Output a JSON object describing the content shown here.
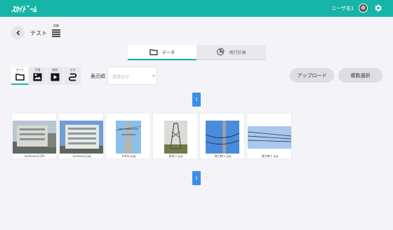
{
  "header": {
    "logo_text": "ｽｶｲﾄﾞｰﾑ",
    "user_name": "ユーザ名1",
    "icons": [
      "avatar",
      "gear-icon"
    ]
  },
  "page": {
    "title": "テスト",
    "detail_label": "詳細"
  },
  "tabs": [
    {
      "label": "データ",
      "icon": "folder-icon",
      "active": true
    },
    {
      "label": "飛行計画",
      "icon": "pie-chart-icon",
      "active": false
    }
  ],
  "filters": [
    {
      "label": "すべて",
      "icon": "folder-icon",
      "active": true
    },
    {
      "label": "写真",
      "icon": "image-icon",
      "active": false
    },
    {
      "label": "動画",
      "icon": "play-icon",
      "active": false
    },
    {
      "label": "ログ",
      "icon": "route-icon",
      "active": false
    }
  ],
  "sort": {
    "label": "表示順",
    "placeholder": "登録日付"
  },
  "buttons": {
    "upload": "アップロード",
    "multi_select": "複数選択"
  },
  "pagination": {
    "prev": "‹",
    "current": "1",
    "next": "›"
  },
  "files": [
    {
      "name": "kyokusya2.JPG",
      "kind": "building-photo"
    },
    {
      "name": "kyokusya.jpg",
      "kind": "building-photo"
    },
    {
      "name": "tettou.jpg",
      "kind": "tower-photo"
    },
    {
      "name": "鉄塔２.jpg",
      "kind": "tower-photo"
    },
    {
      "name": "電力線２.jpg",
      "kind": "pole-photo"
    },
    {
      "name": "電力線１.jpg",
      "kind": "wires-photo"
    }
  ],
  "colors": {
    "brand": "#16b5a8",
    "page_active": "#3d8fe8",
    "background": "#f4f3f7"
  }
}
